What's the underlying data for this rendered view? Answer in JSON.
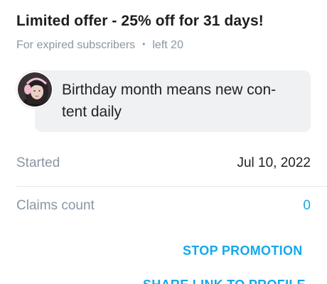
{
  "offer": {
    "title": "Limited offer - 25% off for 31 days!",
    "audience": "For expired subscribers",
    "separator": "•",
    "remaining": "left 20"
  },
  "message": {
    "text": "Birthday month means new con-tent daily"
  },
  "details": {
    "started_label": "Started",
    "started_value": "Jul 10, 2022",
    "claims_label": "Claims count",
    "claims_value": "0"
  },
  "actions": {
    "stop_label": "STOP PROMOTION",
    "share_label": "SHARE LINK TO PROFILE"
  },
  "colors": {
    "accent": "#14a8ec",
    "muted_text": "#8a96a3",
    "bubble_bg": "#f0f1f3"
  }
}
